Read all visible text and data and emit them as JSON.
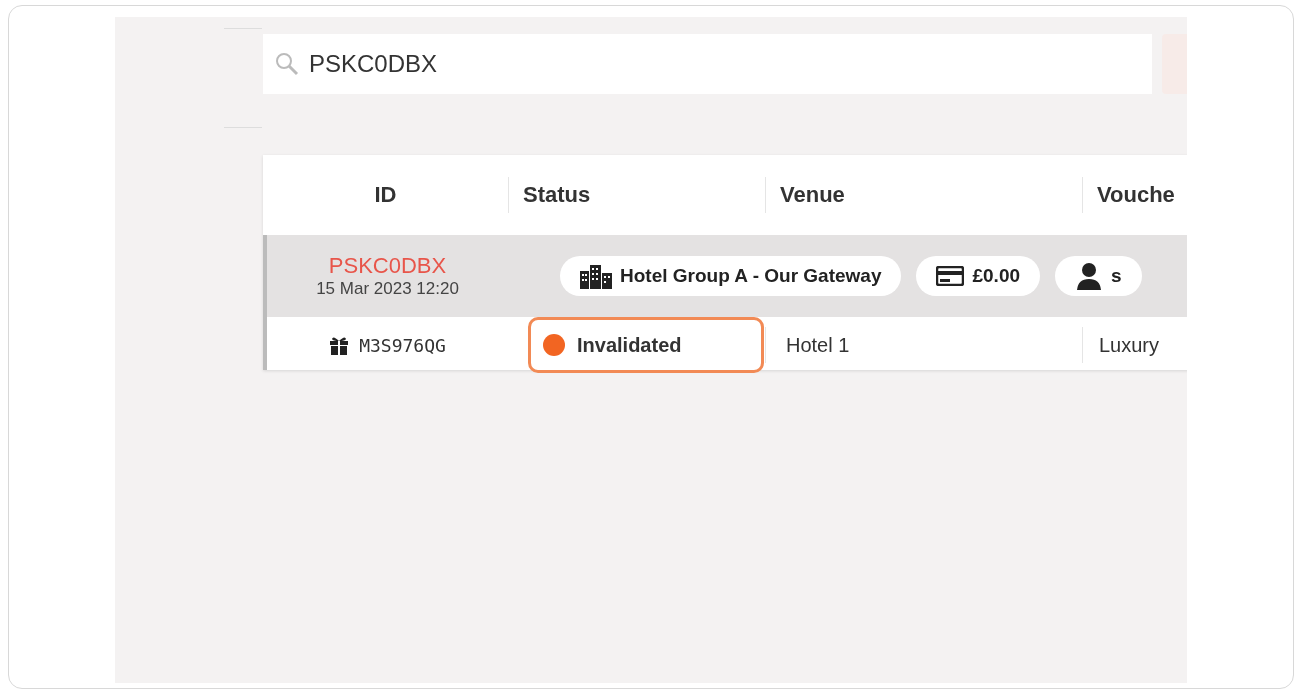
{
  "search": {
    "value": "PSKC0DBX"
  },
  "table": {
    "columns": [
      "ID",
      "Status",
      "Venue",
      "Vouche"
    ],
    "groups": [
      {
        "id": "PSKC0DBX",
        "date": "15 Mar 2023 12:20",
        "chips": [
          {
            "kind": "venue",
            "label": "Hotel Group A - Our Gateway"
          },
          {
            "kind": "amount",
            "label": "£0.00"
          },
          {
            "kind": "user",
            "label": "s"
          }
        ],
        "rows": [
          {
            "code": "M3S976QG",
            "status": {
              "label": "Invalidated",
              "color": "#f26522",
              "highlighted": true
            },
            "venue": "Hotel 1",
            "column_4": "Luxury"
          }
        ]
      }
    ]
  }
}
